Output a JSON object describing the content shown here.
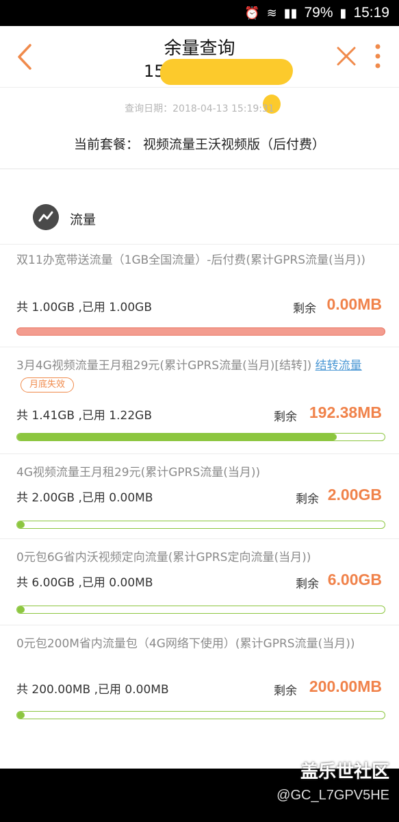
{
  "status_bar": {
    "battery": "79%",
    "time": "15:19"
  },
  "header": {
    "title": "余量查询",
    "phone_visible": "15",
    "colors": {
      "accent": "#f08a4b"
    }
  },
  "query_date": "查询日期：2018-04-13 15:19:31",
  "plan": "当前套餐： 视频流量王沃视频版（后付费）",
  "section": {
    "title": "流量",
    "icon": "flow-icon"
  },
  "items": [
    {
      "name": "双11办宽带送流量（1GB全国流量）-后付费(累计GPRS流量(当月))",
      "usage": "共 1.00GB ,已用 1.00GB",
      "remain_label": "剩余",
      "remain_value": "0.00MB",
      "used_fraction": 1.0
    },
    {
      "name": "3月4G视频流量王月租29元(累计GPRS流量(当月)[结转])",
      "link": "结转流量",
      "badge": "月底失效",
      "usage": "共 1.41GB ,已用 1.22GB",
      "remain_label": "剩余",
      "remain_value": "192.38MB",
      "remaining_fraction": 0.87
    },
    {
      "name": "4G视频流量王月租29元(累计GPRS流量(当月))",
      "usage": "共 2.00GB ,已用 0.00MB",
      "remain_label": "剩余",
      "remain_value": "2.00GB",
      "remaining_fraction": 0.02
    },
    {
      "name": "0元包6G省内沃视频定向流量(累计GPRS定向流量(当月))",
      "usage": "共 6.00GB ,已用 0.00MB",
      "remain_label": "剩余",
      "remain_value": "6.00GB",
      "remaining_fraction": 0.02
    },
    {
      "name": "0元包200M省内流量包（4G网络下使用）(累计GPRS流量(当月))",
      "usage": "共 200.00MB ,已用 0.00MB",
      "remain_label": "剩余",
      "remain_value": "200.00MB",
      "remaining_fraction": 0.02
    }
  ],
  "watermark": {
    "main": "盖乐世社区",
    "sub": "@GC_L7GPV5HE"
  }
}
